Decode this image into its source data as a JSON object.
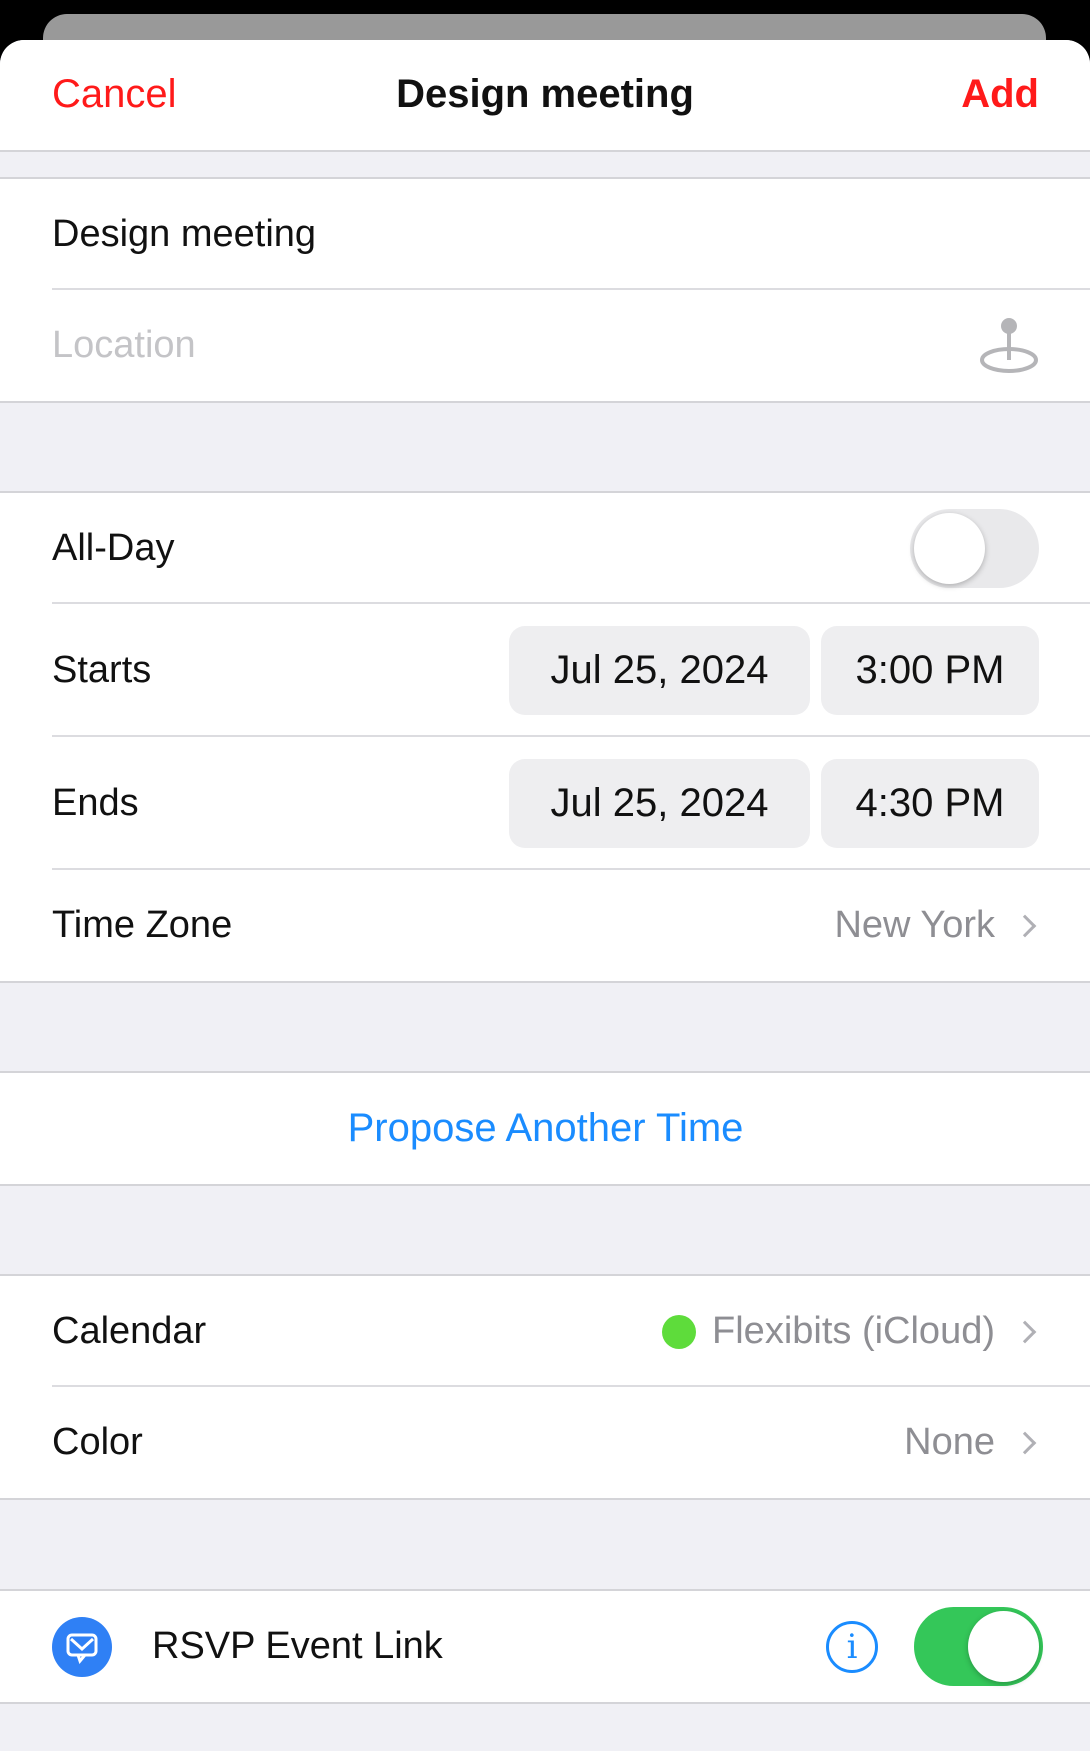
{
  "nav": {
    "cancel": "Cancel",
    "title": "Design meeting",
    "add": "Add"
  },
  "event": {
    "title": "Design meeting",
    "location_placeholder": "Location",
    "location_icon": "map-pin-icon"
  },
  "schedule": {
    "all_day_label": "All-Day",
    "all_day_on": false,
    "starts_label": "Starts",
    "starts_date": "Jul 25, 2024",
    "starts_time": "3:00 PM",
    "ends_label": "Ends",
    "ends_date": "Jul 25, 2024",
    "ends_time": "4:30 PM",
    "timezone_label": "Time Zone",
    "timezone_value": "New York"
  },
  "propose": "Propose Another Time",
  "calendar": {
    "label": "Calendar",
    "value": "Flexibits (iCloud)",
    "dot_color": "#5edc3b",
    "color_label": "Color",
    "color_value": "None"
  },
  "rsvp": {
    "label": "RSVP Event Link",
    "enabled": true,
    "icon": "envelope-icon"
  },
  "colors": {
    "accent": "#ff1a1a",
    "link": "#1a8cff",
    "toggle_on": "#34c759"
  }
}
